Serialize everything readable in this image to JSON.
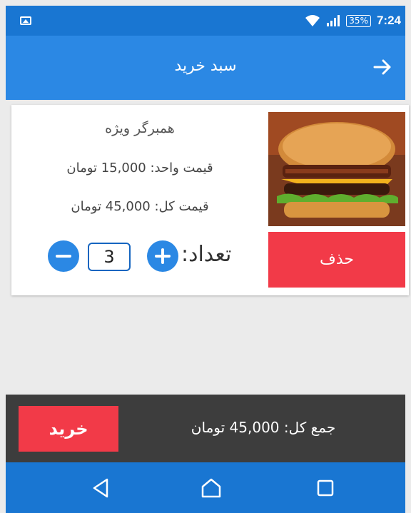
{
  "status_bar": {
    "battery": "35%",
    "time": "7:24",
    "icons": [
      "gallery-icon",
      "wifi-icon",
      "signal-icon",
      "battery-icon"
    ]
  },
  "app_bar": {
    "title": "سبد خرید",
    "back_icon": "arrow-right-icon"
  },
  "cart_item": {
    "name": "همبرگر ویژه",
    "unit_price": "قیمت واحد: 15,000 تومان",
    "total_price": "قیمت کل: 45,000 تومان",
    "quantity_label": "تعداد:",
    "quantity_value": "3",
    "delete_label": "حذف",
    "image": "burger-image"
  },
  "bottom_bar": {
    "grand_total": "جمع کل: 45,000 تومان",
    "buy_label": "خرید"
  },
  "nav_bar": {
    "icons": [
      "nav-back-icon",
      "nav-home-icon",
      "nav-recent-icon"
    ]
  },
  "colors": {
    "primary": "#2b88e4",
    "primary_dark": "#1976d2",
    "accent_red": "#f23a48",
    "bottom_bar": "#3d3d3d"
  }
}
